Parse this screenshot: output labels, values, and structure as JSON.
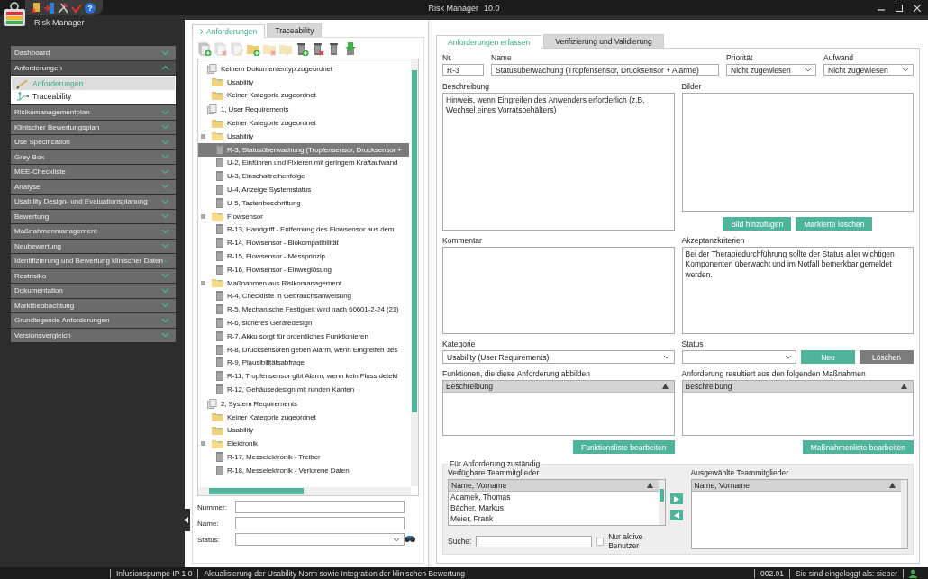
{
  "window": {
    "title": "Risk Manager",
    "version": "10.0"
  },
  "app": {
    "name": "Risk Manager",
    "help": "?"
  },
  "sidebar": {
    "items": [
      {
        "label": "Dashboard",
        "expanded": false
      },
      {
        "label": "Anforderungen",
        "expanded": true,
        "children": [
          {
            "label": "Anforderungen",
            "selected": true
          },
          {
            "label": "Traceability",
            "selected": false
          }
        ]
      },
      {
        "label": "Risikomanagementplan",
        "expanded": false
      },
      {
        "label": "Klinischer Bewertungsplan",
        "expanded": false
      },
      {
        "label": "Use Specification",
        "expanded": false
      },
      {
        "label": "Grey Box",
        "expanded": false
      },
      {
        "label": "MEE-Checkliste",
        "expanded": false
      },
      {
        "label": "Analyse",
        "expanded": false
      },
      {
        "label": "Usability Design- und Evaluationsplanung",
        "expanded": false
      },
      {
        "label": "Bewertung",
        "expanded": false
      },
      {
        "label": "Maßnahmenmanagement",
        "expanded": false
      },
      {
        "label": "Neubewertung",
        "expanded": false
      },
      {
        "label": "Identifizierung und Bewertung klinischer Daten",
        "expanded": false
      },
      {
        "label": "Restrisiko",
        "expanded": false
      },
      {
        "label": "Dokumentation",
        "expanded": false
      },
      {
        "label": "Marktbeobachtung",
        "expanded": false
      },
      {
        "label": "Grundlegende Anforderungen",
        "expanded": false
      },
      {
        "label": "Versionsvergleich",
        "expanded": false
      }
    ]
  },
  "left_tabs": [
    {
      "label": "Anforderungen",
      "selected": true
    },
    {
      "label": "Traceability",
      "selected": false
    }
  ],
  "tree": [
    {
      "label": "Keinem Dokumententyp zugeordnet",
      "kind": "doctype",
      "selected": false,
      "children": [
        {
          "label": "Usability",
          "kind": "folder",
          "selected": false
        },
        {
          "label": "Keiner Kategorie zugeordnet",
          "kind": "folder",
          "selected": false
        }
      ]
    },
    {
      "label": "1, User Requirements",
      "kind": "doctype",
      "selected": false,
      "children": [
        {
          "label": "Keiner Kategorie zugeordnet",
          "kind": "folder",
          "selected": false
        },
        {
          "label": "Usability",
          "kind": "folder",
          "selected": false,
          "children": [
            {
              "label": "R-3, Statusüberwachung (Tropfensensor, Drucksensor +",
              "kind": "item",
              "selected": true
            },
            {
              "label": "U-2, Einführen und Fixieren mit geringem Kraftaufwand",
              "kind": "item",
              "selected": false
            },
            {
              "label": "U-3, Einschaltreihenfolge",
              "kind": "item",
              "selected": false
            },
            {
              "label": "U-4, Anzeige Systemstatus",
              "kind": "item",
              "selected": false
            },
            {
              "label": "U-5, Tastenbeschriftung",
              "kind": "item",
              "selected": false
            }
          ]
        },
        {
          "label": "Flowsensor",
          "kind": "folder",
          "selected": false,
          "children": [
            {
              "label": "R-13, Handgriff - Entfernung des Flowsensor aus dem",
              "kind": "item",
              "selected": false
            },
            {
              "label": "R-14, Flowsensor - Biokompatibilität",
              "kind": "item",
              "selected": false
            },
            {
              "label": "R-15, Flowsensor - Messprinzip",
              "kind": "item",
              "selected": false
            },
            {
              "label": "R-16, Flowsensor - Einweglösung",
              "kind": "item",
              "selected": false
            }
          ]
        },
        {
          "label": "Maßnahmen aus Risikomanagement",
          "kind": "folder",
          "selected": false,
          "children": [
            {
              "label": "R-4, Checkliste in Gebrauchsanweisung",
              "kind": "item",
              "selected": false
            },
            {
              "label": "R-5, Mechanische Festigkeit wird nach 60601-2-24 (21)",
              "kind": "item",
              "selected": false
            },
            {
              "label": "R-6, sicheres Gerätedesign",
              "kind": "item",
              "selected": false
            },
            {
              "label": "R-7, Akku sorgt für ordentliches Funktionieren",
              "kind": "item",
              "selected": false
            },
            {
              "label": "R-8, Drucksensoren geben Alarm, wenn Eingreifen des",
              "kind": "item",
              "selected": false
            },
            {
              "label": "R-9, Plausibilitätsabfrage",
              "kind": "item",
              "selected": false
            },
            {
              "label": "R-11, Tropfensensor gibt Alarm, wenn kein Fluss detekt",
              "kind": "item",
              "selected": false
            },
            {
              "label": "R-12, Gehäusedesign mit runden Kanten",
              "kind": "item",
              "selected": false
            }
          ]
        }
      ]
    },
    {
      "label": "2, System Requirements",
      "kind": "doctype",
      "selected": false,
      "children": [
        {
          "label": "Keiner Kategorie zugeordnet",
          "kind": "folder",
          "selected": false
        },
        {
          "label": "Usability",
          "kind": "folder",
          "selected": false
        },
        {
          "label": "Elektronik",
          "kind": "folder",
          "selected": false,
          "children": [
            {
              "label": "R-17, Messelektronik - Treiber",
              "kind": "item",
              "selected": false
            },
            {
              "label": "R-18, Messelektronik - Verlorene Daten",
              "kind": "item",
              "selected": false
            }
          ]
        }
      ]
    }
  ],
  "filter": [
    {
      "label": "Nummer:",
      "kind": "text"
    },
    {
      "label": "Name:",
      "kind": "text"
    },
    {
      "label": "Status:",
      "kind": "select"
    }
  ],
  "right_tabs": [
    {
      "label": "Anforderungen erfassen",
      "selected": true
    },
    {
      "label": "Verifizierung und Validierung",
      "selected": false
    }
  ],
  "form": {
    "nr": {
      "label": "Nr.",
      "value": "R-3"
    },
    "name": {
      "label": "Name",
      "value": "Statusüberwachung (Tropfensensor, Drucksensor + Alarme)"
    },
    "priority": {
      "label": "Priorität",
      "value": "Nicht zugewiesen"
    },
    "effort": {
      "label": "Aufwand",
      "value": "Nicht zugewiesen"
    },
    "description": {
      "label": "Beschreibung",
      "value": "Hinweis, wenn Eingreifen des Anwenders erforderlich (z.B. Wechsel eines Vorratsbehälters)"
    },
    "images": {
      "label": "Bilder",
      "buttons": [
        "Bild hinzufügen",
        "Markierte löschen"
      ]
    },
    "comment": {
      "label": "Kommentar"
    },
    "acceptance": {
      "label": "Akzeptanzkriterien",
      "value": "Bei der Therapiedurchführung sollte der Status aller wichtigen Komponenten überwacht und im Notfall bemerkbar gemeldet werden."
    },
    "category": {
      "label": "Kategorie",
      "value": "Usability (User Requirements)"
    },
    "status": {
      "label": "Status"
    },
    "status_buttons": [
      {
        "label": "Neu",
        "kind": "primary"
      },
      {
        "label": "Löschen",
        "kind": "secondary"
      }
    ],
    "functions": {
      "label": "Funktionen, die diese Anforderung abbilden",
      "column": "Beschreibung",
      "button": "Funktionsliste bearbeiten"
    },
    "measures": {
      "label": "Anforderung resultiert aus den folgenden Maßnahmen",
      "column": "Beschreibung",
      "button": "Maßnahmenliste bearbeiten"
    },
    "responsible": {
      "title": "Für Anforderung zuständig",
      "available": {
        "label": "Verfügbare Teammitglieder",
        "column": "Name, Vorname",
        "rows": [
          "Adamek, Thomas",
          "Bächer, Markus",
          "Meier, Frank"
        ]
      },
      "chosen": {
        "label": "Ausgewählte Teammitglieder",
        "column": "Name, Vorname"
      },
      "search_label": "Suche:",
      "active_only": {
        "label": "Nur aktive Benutzer",
        "checked": false
      }
    }
  },
  "status_bar": {
    "project": "Infusionspumpe IP 1.0",
    "message": "Aktualisierung der Usability Norm sowie Integration der klinischen Bewertung",
    "version": "002.01",
    "user": "Sie sind eingeloggt als: sieber"
  }
}
